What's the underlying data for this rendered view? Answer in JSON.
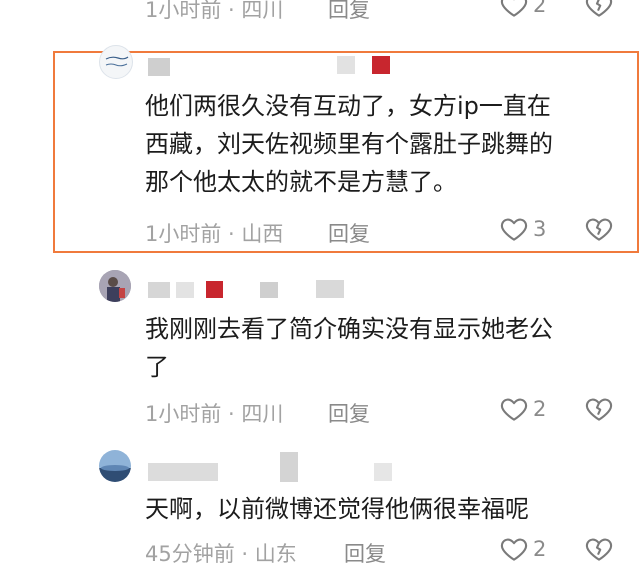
{
  "comments": [
    {
      "meta": "1小时前 · 四川",
      "reply": "回复",
      "likes": "2"
    },
    {
      "text_lines": [
        "他们两很久没有互动了，女方ip一直在",
        "西藏，刘天佐视频里有个露肚子跳舞的",
        "那个他太太的就不是方慧了。"
      ],
      "meta": "1小时前 · 山西",
      "reply": "回复",
      "likes": "3",
      "highlighted": true
    },
    {
      "text_lines": [
        "我刚刚去看了简介确实没有显示她老公",
        "了"
      ],
      "meta": "1小时前 · 四川",
      "reply": "回复",
      "likes": "2"
    },
    {
      "text_lines": [
        "天啊，以前微博还觉得他俩很幸福呢"
      ],
      "meta": "45分钟前 · 山东",
      "reply": "回复",
      "likes": "2"
    }
  ],
  "colors": {
    "highlight_border": "#f07a3c",
    "meta_text": "#a2a2a2",
    "body_text": "#1c1c1c",
    "redacted_red": "#c8262e"
  }
}
